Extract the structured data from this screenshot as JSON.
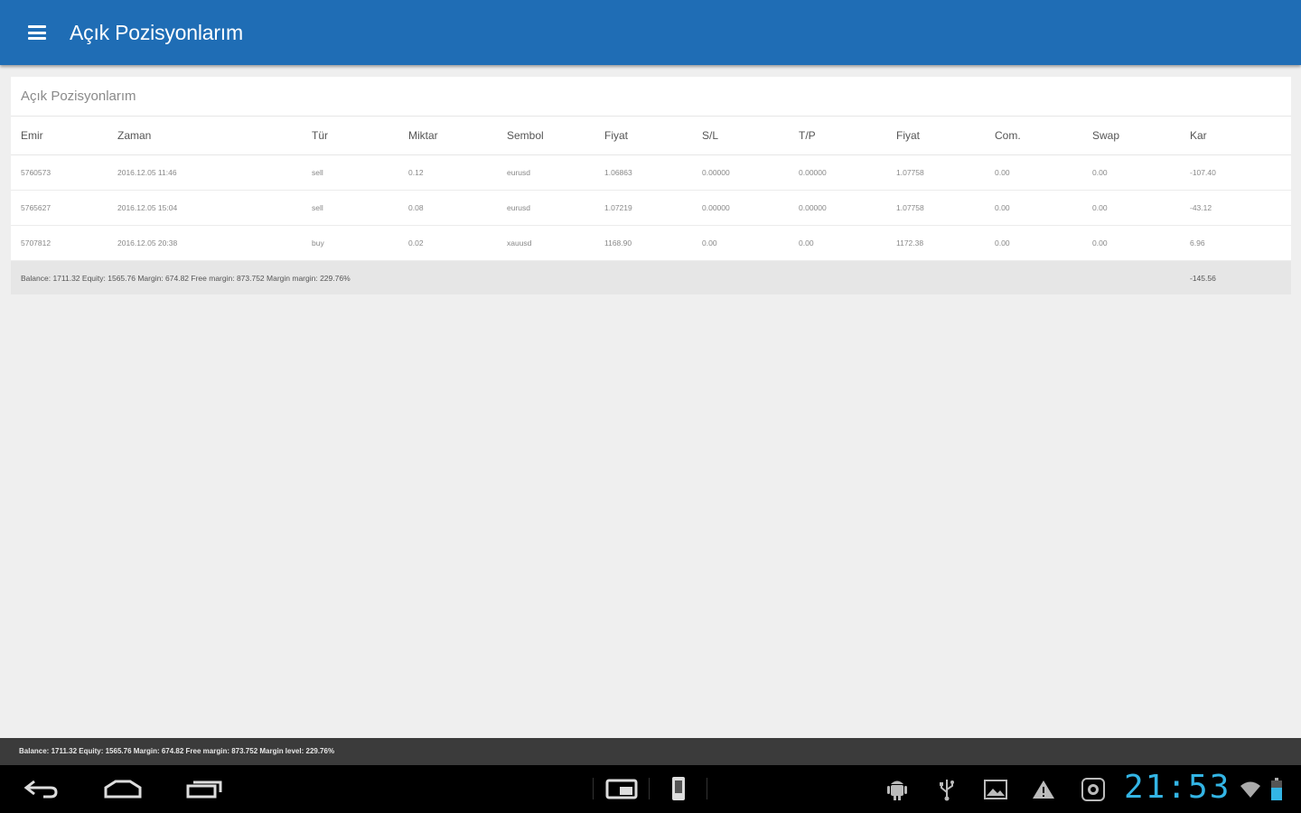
{
  "appbar": {
    "title": "Açık Pozisyonlarım"
  },
  "card": {
    "title": "Açık Pozisyonlarım",
    "columns": [
      "Emir",
      "Zaman",
      "Tür",
      "Miktar",
      "Sembol",
      "Fiyat",
      "S/L",
      "T/P",
      "Fiyat",
      "Com.",
      "Swap",
      "Kar"
    ],
    "rows": [
      [
        "5760573",
        "2016.12.05 11:46",
        "sell",
        "0.12",
        "eurusd",
        "1.06863",
        "0.00000",
        "0.00000",
        "1.07758",
        "0.00",
        "0.00",
        "-107.40"
      ],
      [
        "5765627",
        "2016.12.05 15:04",
        "sell",
        "0.08",
        "eurusd",
        "1.07219",
        "0.00000",
        "0.00000",
        "1.07758",
        "0.00",
        "0.00",
        "-43.12"
      ],
      [
        "5707812",
        "2016.12.05 20:38",
        "buy",
        "0.02",
        "xauusd",
        "1168.90",
        "0.00",
        "0.00",
        "1172.38",
        "0.00",
        "0.00",
        "6.96"
      ]
    ],
    "summary": {
      "text": "Balance: 1711.32 Equity: 1565.76 Margin: 674.82 Free margin: 873.752 Margin margin: 229.76%",
      "total": "-145.56"
    }
  },
  "bottom_status": {
    "text": "Balance: 1711.32  Equity: 1565.76  Margin: 674.82  Free margin: 873.752  Margin level: 229.76%"
  },
  "system": {
    "clock": "21:53",
    "icons": [
      "back-icon",
      "home-icon",
      "recent-apps-icon",
      "screenshot-icon",
      "phone-icon",
      "android-icon",
      "usb-icon",
      "gallery-icon",
      "warning-icon",
      "app-icon",
      "wifi-icon",
      "battery-icon"
    ]
  }
}
